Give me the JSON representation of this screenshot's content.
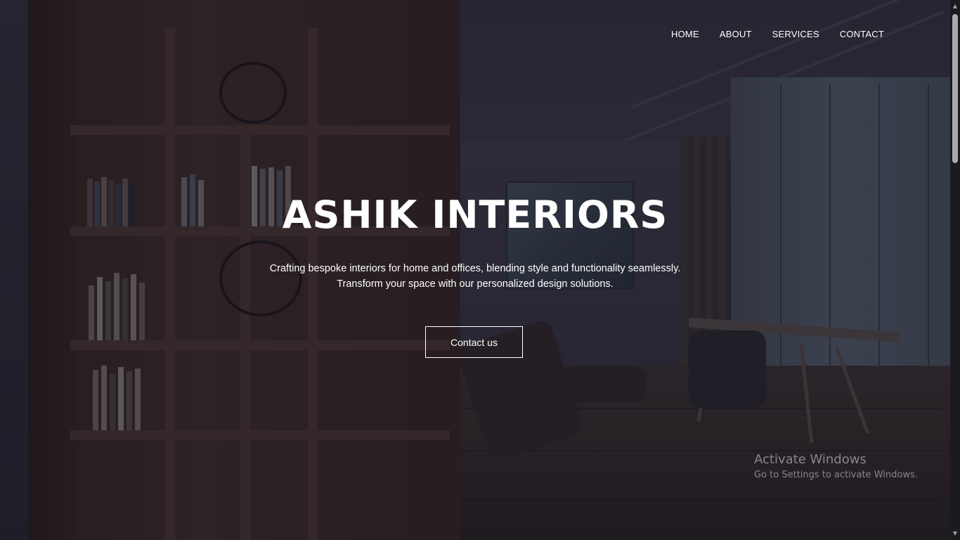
{
  "nav": {
    "items": [
      {
        "label": "HOME"
      },
      {
        "label": "ABOUT"
      },
      {
        "label": "SERVICES"
      },
      {
        "label": "CONTACT"
      }
    ]
  },
  "hero": {
    "title": "ASHIK INTERIORS",
    "subtitle_line1": "Crafting bespoke interiors for home and offices, blending style and functionality seamlessly.",
    "subtitle_line2": "Transform your space with our personalized design solutions.",
    "cta_label": "Contact us"
  },
  "watermark": {
    "title": "Activate Windows",
    "subtitle": "Go to Settings to activate Windows."
  },
  "colors": {
    "text": "#ffffff",
    "overlay": "#161422",
    "scrollbar_track": "#1b1b1f",
    "scrollbar_thumb": "#a9a9ad"
  },
  "icons": {
    "scroll_up": "scroll-up-arrow-icon",
    "scroll_down": "scroll-down-arrow-icon"
  }
}
